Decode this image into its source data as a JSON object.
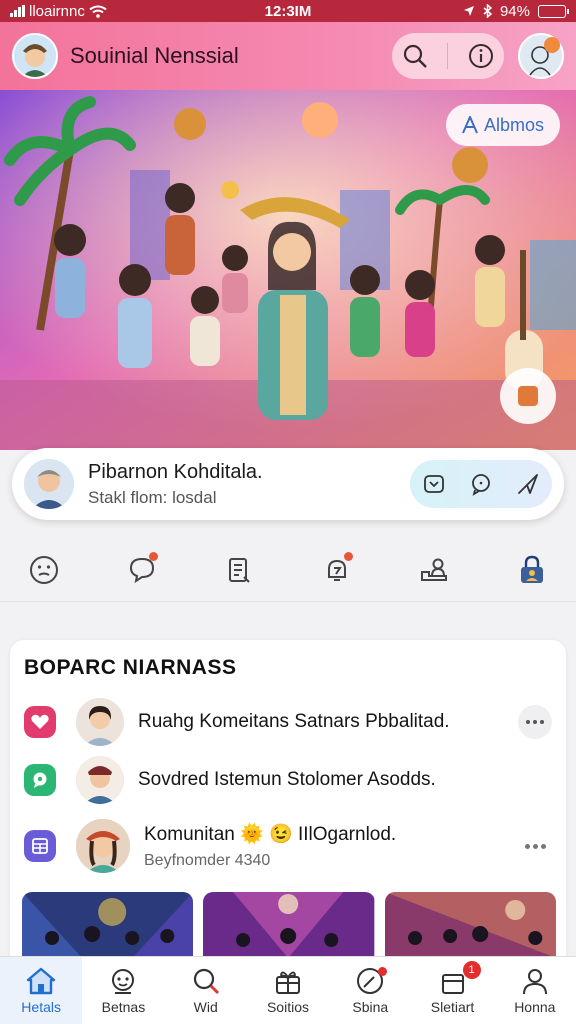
{
  "status_bar": {
    "carrier": "lloairnnc",
    "time": "12:3IM",
    "battery": "94%"
  },
  "header": {
    "title": "Souinial Nenssial"
  },
  "hero": {
    "albums_label": "Albmos"
  },
  "profile": {
    "name": "Pibarnon Kohditala.",
    "subtitle": "Stakl flom: losdal"
  },
  "section": {
    "title": "BOPARC NIARNASS",
    "items": [
      {
        "text": "Ruahg Komeitans Satnars Pbbalitad."
      },
      {
        "text": "Sovdred Istemun Stolomer Asodds."
      },
      {
        "text": "Komunitan 🌞 😉 IIlOgarnlod.",
        "sub": "Beyfnomder 4340"
      }
    ]
  },
  "tabs": [
    {
      "label": "Hetals",
      "icon": "home-icon"
    },
    {
      "label": "Betnas",
      "icon": "mascot-icon"
    },
    {
      "label": "Wid",
      "icon": "search-icon"
    },
    {
      "label": "Soitios",
      "icon": "gift-icon"
    },
    {
      "label": "Sbina",
      "icon": "explore-icon"
    },
    {
      "label": "Sletiart",
      "icon": "inbox-icon",
      "badge": "1"
    },
    {
      "label": "Honna",
      "icon": "profile-icon"
    }
  ],
  "colors": {
    "header_pink": "#f58ab2",
    "status_red": "#b8283c",
    "accent_blue": "#1f6fd1",
    "badge_red": "#e42d2d"
  }
}
